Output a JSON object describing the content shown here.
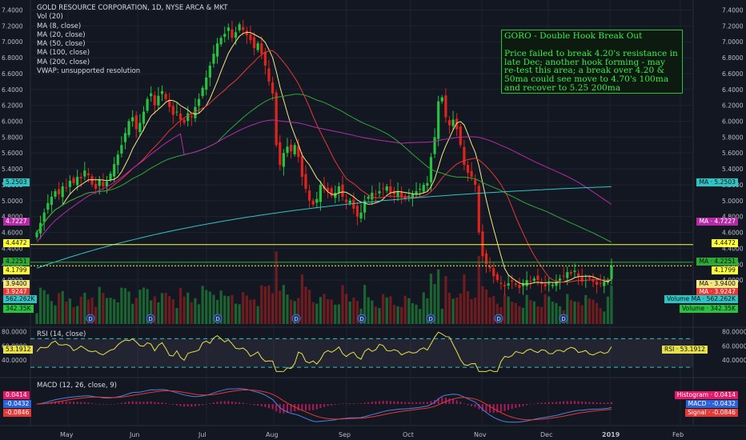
{
  "header": {
    "symbol_line": "GOLD RESOURCE CORPORATION, 1D, NYSE ARCA & MKT",
    "indicators": [
      "Vol (20)",
      "MA (8, close)",
      "MA (20, close)",
      "MA (50, close)",
      "MA (100, close)",
      "MA (200, close)",
      "VWAP: unsupported resolution"
    ]
  },
  "note": {
    "title": "GORO - Double Hook Break Out",
    "body": "Price failed to break 4.20's resistance in late Dec; another hook forming - may re-test this area; a break over 4.20 & 50ma could see move to 4.70's 100ma and recover to 5.25 200ma"
  },
  "rsi": {
    "label": "RSI (14, close)",
    "value": "53.1912",
    "tag": "RSI"
  },
  "macd": {
    "label": "MACD (12, 26, close, 9)"
  },
  "colors": {
    "bg": "#131722",
    "up": "#26c240",
    "down": "#e0241c",
    "grid": "#1e2330",
    "ma8": "#f2e782",
    "ma20": "#e53935",
    "ma50": "#2fa836",
    "ma100": "#b52ba6",
    "ma200": "#2ec4c6",
    "hline": "#ffff33"
  },
  "chart_data": [
    {
      "type": "candlestick",
      "title": "GOLD RESOURCE CORPORATION, 1D, NYSE ARCA & MKT",
      "x_ticks": [
        "May",
        "Jun",
        "Jul",
        "Aug",
        "Sep",
        "Oct",
        "Nov",
        "Dec",
        "2019",
        "Feb"
      ],
      "y_ticks": [
        "4.0000",
        "4.2000",
        "4.4000",
        "4.6000",
        "4.8000",
        "5.0000",
        "5.2000",
        "5.4000",
        "5.6000",
        "5.8000",
        "6.0000",
        "6.2000",
        "6.4000",
        "6.6000",
        "6.8000",
        "7.0000",
        "7.2000",
        "7.4000"
      ],
      "ylim": [
        3.9,
        7.45
      ],
      "close": [
        4.6,
        4.72,
        4.85,
        4.97,
        5.05,
        5.12,
        5.08,
        5.18,
        5.16,
        5.25,
        5.22,
        5.3,
        5.28,
        5.38,
        5.32,
        5.2,
        5.15,
        5.26,
        5.18,
        5.24,
        5.34,
        5.46,
        5.58,
        5.7,
        5.85,
        6.0,
        6.05,
        5.9,
        5.98,
        6.12,
        6.28,
        6.35,
        6.2,
        6.32,
        6.38,
        6.28,
        6.18,
        6.08,
        6.12,
        6.02,
        5.98,
        6.1,
        6.05,
        6.18,
        6.28,
        6.42,
        6.55,
        6.7,
        6.85,
        6.98,
        7.05,
        7.1,
        7.18,
        7.05,
        7.12,
        7.22,
        7.15,
        7.08,
        7.02,
        6.92,
        6.98,
        6.85,
        6.7,
        6.5,
        6.35,
        5.7,
        5.45,
        5.6,
        5.68,
        5.62,
        5.7,
        5.55,
        5.3,
        5.15,
        5.0,
        4.95,
        5.02,
        5.2,
        5.15,
        5.12,
        5.06,
        5.1,
        5.18,
        5.05,
        4.98,
        5.0,
        4.9,
        4.8,
        4.85,
        5.0,
        5.05,
        5.1,
        5.08,
        5.12,
        5.15,
        5.18,
        5.1,
        5.08,
        5.12,
        5.05,
        5.02,
        5.06,
        5.08,
        5.12,
        5.15,
        5.2,
        5.22,
        5.55,
        5.8,
        6.25,
        6.3,
        6.05,
        5.95,
        6.02,
        5.9,
        5.7,
        5.45,
        5.35,
        5.3,
        5.2,
        4.6,
        4.3,
        4.2,
        4.15,
        4.05,
        4.0,
        3.95,
        3.92,
        3.96,
        3.98,
        3.94,
        3.9,
        3.96,
        4.0,
        3.98,
        4.02,
        4.0,
        3.95,
        3.92,
        3.96,
        3.94,
        3.98,
        4.02,
        4.05,
        4.1,
        4.08,
        4.12,
        4.05,
        3.98,
        4.0,
        4.02,
        3.98,
        3.94,
        3.96,
        3.98,
        4.0,
        4.18
      ],
      "volume_scale_label": "562.262K",
      "price_labels": [
        {
          "text": "5.2503",
          "color": "#2ec4c6",
          "right": "MA · 5.2503"
        },
        {
          "text": "4.7227",
          "color": "#b52ba6",
          "right": "MA · 4.7227"
        },
        {
          "text": "4.4472",
          "color": "#ffff33",
          "right": "4.4472"
        },
        {
          "text": "4.2251",
          "color": "#2fa836",
          "right": "MA · 4.2251"
        },
        {
          "text": "4.1799",
          "color": "#ffff33",
          "right": "4.1799"
        },
        {
          "text": "3.9400",
          "color": "#f2e782",
          "right": "MA · 3.9400"
        },
        {
          "text": "3.9247",
          "color": "#e53935",
          "right": "MA · 3.9247"
        },
        {
          "text": "562.262K",
          "color": "#2ec4c6",
          "right": "Volume MA · 562.262K"
        },
        {
          "text": "342.35K",
          "color": "#26c240",
          "right": "Volume · 342.35K"
        }
      ],
      "horizontal_lines": [
        4.4472,
        4.2251,
        4.1799
      ]
    },
    {
      "type": "line",
      "title": "RSI (14, close)",
      "y_ticks": [
        "40.0000",
        "60.0000",
        "80.0000"
      ],
      "ylim": [
        20,
        85
      ],
      "bands": [
        30,
        70
      ],
      "last": 53.1912
    },
    {
      "type": "line",
      "title": "MACD (12, 26, close, 9)",
      "labels": [
        {
          "text": "0.0414",
          "right": "Histogram · 0.0414",
          "color": "#e5196a"
        },
        {
          "text": "-0.0432",
          "right": "MACD · -0.0432",
          "color": "#2a63d6"
        },
        {
          "text": "-0.0846",
          "right": "Signal · -0.0846",
          "color": "#e53935"
        }
      ]
    }
  ]
}
